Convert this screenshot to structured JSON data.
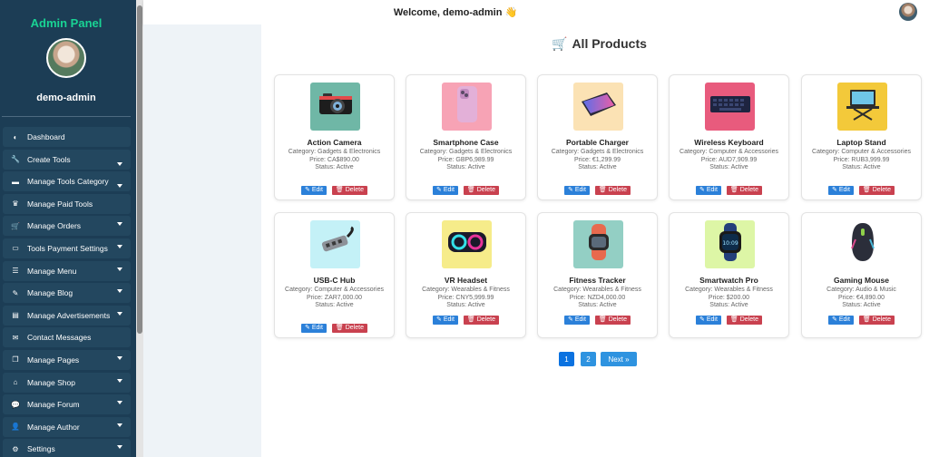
{
  "sidebar": {
    "title": "Admin Panel",
    "username": "demo-admin",
    "items": [
      {
        "label": "Dashboard",
        "icon": "dashboard-icon",
        "glyph": "◐",
        "caret": false
      },
      {
        "label": "Create Tools",
        "icon": "wrench-icon",
        "glyph": "🔧",
        "caret": true
      },
      {
        "label": "Manage Tools Category",
        "icon": "folder-icon",
        "glyph": "▬",
        "caret": true
      },
      {
        "label": "Manage Paid Tools",
        "icon": "crown-icon",
        "glyph": "♛",
        "caret": false
      },
      {
        "label": "Manage Orders",
        "icon": "cart-icon",
        "glyph": "🛒",
        "caret": true
      },
      {
        "label": "Tools Payment Settings",
        "icon": "credit-card-icon",
        "glyph": "▭",
        "caret": true
      },
      {
        "label": "Manage Menu",
        "icon": "list-icon",
        "glyph": "☰",
        "caret": true
      },
      {
        "label": "Manage Blog",
        "icon": "blog-icon",
        "glyph": "✎",
        "caret": true
      },
      {
        "label": "Manage Advertisements",
        "icon": "ad-icon",
        "glyph": "▤",
        "caret": true
      },
      {
        "label": "Contact Messages",
        "icon": "envelope-icon",
        "glyph": "✉",
        "caret": false
      },
      {
        "label": "Manage Pages",
        "icon": "pages-icon",
        "glyph": "❐",
        "caret": true
      },
      {
        "label": "Manage Shop",
        "icon": "shop-icon",
        "glyph": "⌂",
        "caret": true
      },
      {
        "label": "Manage Forum",
        "icon": "forum-icon",
        "glyph": "💬",
        "caret": true
      },
      {
        "label": "Manage Author",
        "icon": "user-icon",
        "glyph": "👤",
        "caret": true
      },
      {
        "label": "Settings",
        "icon": "gear-icon",
        "glyph": "⚙",
        "caret": true
      }
    ]
  },
  "header": {
    "welcome": "Welcome, demo-admin",
    "wave": "👋"
  },
  "main": {
    "title": "All Products",
    "title_icon": "🛒"
  },
  "buttons": {
    "edit": "✎ Edit",
    "delete": "🗑 Delete"
  },
  "products": [
    {
      "name": "Action Camera",
      "meta": [
        "Category: Gadgets & Electronics",
        "Price: CA$890.00",
        "Status: Active"
      ],
      "icon": "camera-icon",
      "bg": "#6fb7a6"
    },
    {
      "name": "Smartphone Case",
      "meta": [
        "Category: Gadgets & Electronics",
        "Price: GBP6,989.99",
        "Status: Active"
      ],
      "icon": "smartphone-icon",
      "bg": "#f7a3b5"
    },
    {
      "name": "Portable Charger",
      "meta": [
        "Category: Gadgets & Electronics",
        "Price: €1,299.99",
        "Status: Active"
      ],
      "icon": "power-bank-icon",
      "bg": "#fbe2b4"
    },
    {
      "name": "Wireless Keyboard",
      "meta": [
        "Category: Computer & Accessories",
        "Price: AUD7,909.99",
        "Status: Active"
      ],
      "icon": "keyboard-icon",
      "bg": "#e85b7d"
    },
    {
      "name": "Laptop Stand",
      "meta": [
        "Category: Computer & Accessories",
        "Price: RUB3,999.99",
        "Status: Active"
      ],
      "icon": "laptop-stand-icon",
      "bg": "#f3c93a"
    },
    {
      "name": "USB-C Hub",
      "meta": [
        "Category: Computer & Accessories",
        "Price: ZAR7,000.00",
        "Status: Active"
      ],
      "icon": "usb-hub-icon",
      "bg": "#c4f1f7"
    },
    {
      "name": "VR Headset",
      "meta": [
        "Category: Wearables & Fitness",
        "Price: CNY5,999.99",
        "Status: Active"
      ],
      "icon": "vr-headset-icon",
      "bg": "#f6ec8a"
    },
    {
      "name": "Fitness Tracker",
      "meta": [
        "Category: Wearables & Fitness",
        "Price: NZD4,000.00",
        "Status: Active"
      ],
      "icon": "fitness-tracker-icon",
      "bg": "#93cfc4"
    },
    {
      "name": "Smartwatch Pro",
      "meta": [
        "Category: Wearables & Fitness",
        "Price: $200.00",
        "Status: Active"
      ],
      "icon": "smartwatch-icon",
      "bg": "#ddf6a6"
    },
    {
      "name": "Gaming Mouse",
      "meta": [
        "Category: Audio & Music",
        "Price: €4,890.00",
        "Status: Active"
      ],
      "icon": "gaming-mouse-icon",
      "bg": "#ffffff"
    }
  ],
  "pagination": {
    "page1": "1",
    "page2": "2",
    "next": "Next »"
  }
}
